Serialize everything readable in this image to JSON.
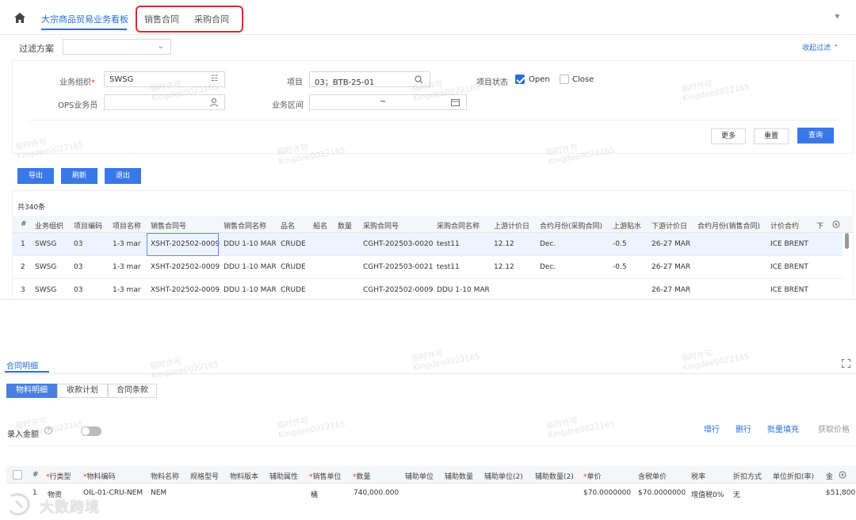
{
  "topbar": {
    "tabs": [
      {
        "label": "大宗商品贸易业务看板",
        "active": true
      },
      {
        "label": "销售合同",
        "active": false
      },
      {
        "label": "采购合同",
        "active": false
      }
    ]
  },
  "filter": {
    "scheme_label": "过滤方案",
    "collapse_label": "收起过滤",
    "org_label": "业务组织",
    "org_value": "SWSG",
    "project_label": "项目",
    "project_value": "03；BTB-25-01",
    "status_label": "项目状态",
    "status_open": "Open",
    "status_close": "Close",
    "ops_label": "OPS业务员",
    "range_label": "业务区间",
    "range_sep": "~",
    "more": "更多",
    "reset": "重置",
    "query": "查询"
  },
  "actions": {
    "export": "导出",
    "refresh": "刷新",
    "exit": "退出"
  },
  "grid": {
    "total": "共340条",
    "columns": [
      "#",
      "业务组织",
      "项目编码",
      "项目名称",
      "销售合同号",
      "销售合同名称",
      "品名",
      "船名",
      "数量",
      "采购合同号",
      "采购合同名称",
      "上游计价日",
      "合约月份(采购合同)",
      "上游贴水",
      "下游计价日",
      "合约月份(销售合同)",
      "计价合约",
      "下"
    ],
    "rows": [
      {
        "idx": "1",
        "org": "SWSG",
        "code": "03",
        "name": "1-3 mar",
        "sale_no": "XSHT-202502-0009",
        "sale_name": "DDU 1-10 MAR",
        "product": "CRUDE",
        "buy_no": "CGHT-202503-0020",
        "buy_name": "test11",
        "up_date": "12.12",
        "buy_month": "Dec.",
        "premium": "-0.5",
        "down_date": "26-27 MAR",
        "contract": "ICE BRENT"
      },
      {
        "idx": "2",
        "org": "SWSG",
        "code": "03",
        "name": "1-3 mar",
        "sale_no": "XSHT-202502-0009",
        "sale_name": "DDU 1-10 MAR",
        "product": "CRUDE",
        "buy_no": "CGHT-202503-0021",
        "buy_name": "test11",
        "up_date": "12.12",
        "buy_month": "Dec.",
        "premium": "-0.5",
        "down_date": "26-27 MAR",
        "contract": "ICE BRENT"
      },
      {
        "idx": "3",
        "org": "SWSG",
        "code": "03",
        "name": "1-3 mar",
        "sale_no": "XSHT-202502-0009",
        "sale_name": "DDU 1-10 MAR",
        "product": "CRUDE",
        "buy_no": "CGHT-202502-0009",
        "buy_name": "DDU 1-10 MAR",
        "up_date": "",
        "buy_month": "",
        "premium": "",
        "down_date": "26-27 MAR",
        "contract": "ICE BRENT"
      }
    ]
  },
  "detail": {
    "title": "合同明细",
    "tabs": [
      "物料明细",
      "收款计划",
      "合同条款"
    ],
    "amount_label": "录入金额",
    "toolbar": {
      "add_row": "增行",
      "del_row": "删行",
      "batch_fill": "批量填充",
      "get_price": "获取价格"
    },
    "columns": [
      "#",
      "行类型",
      "物料编码",
      "物料名称",
      "规格型号",
      "物料版本",
      "辅助属性",
      "销售单位",
      "数量",
      "辅助单位",
      "辅助数量",
      "辅助单位(2)",
      "辅助数量(2)",
      "单价",
      "含税单价",
      "税率",
      "折扣方式",
      "单位折扣(率)",
      "金"
    ],
    "row": {
      "idx": "1",
      "type": "物资",
      "code": "OIL-01-CRU-NEM",
      "name": "NEM",
      "unit": "桶",
      "qty": "740,000.000",
      "price": "$70.0000000",
      "tax_price": "$70.0000000",
      "tax": "增值税0%",
      "discount": "无",
      "amount": "$51,800"
    }
  },
  "watermark": {
    "line1": "临时许可",
    "line2": "Kingdee0022165"
  },
  "brand": {
    "text": "大数跨境"
  }
}
